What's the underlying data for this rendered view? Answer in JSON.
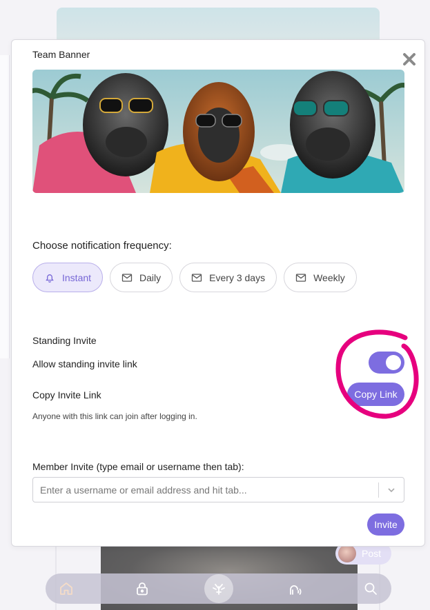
{
  "modal": {
    "banner_label": "Team Banner",
    "frequency_label": "Choose notification frequency:",
    "frequency_options": [
      {
        "label": "Instant",
        "icon": "bell-icon",
        "selected": true
      },
      {
        "label": "Daily",
        "icon": "mail-icon",
        "selected": false
      },
      {
        "label": "Every 3 days",
        "icon": "mail-icon",
        "selected": false
      },
      {
        "label": "Weekly",
        "icon": "mail-icon",
        "selected": false
      }
    ],
    "standing_invite_title": "Standing Invite",
    "allow_standing_label": "Allow standing invite link",
    "allow_standing_enabled": true,
    "copy_invite_label": "Copy Invite Link",
    "copy_button": "Copy Link",
    "helper_text": "Anyone with this link can join after logging in.",
    "member_invite_label": "Member Invite (type email or username then tab):",
    "member_invite_placeholder": "Enter a username or email address and hit tab...",
    "invite_button": "Invite"
  },
  "background": {
    "post_button": "Post"
  },
  "bottom_nav": [
    {
      "icon": "home-icon"
    },
    {
      "icon": "lock-icon"
    },
    {
      "icon": "community-logo-icon"
    },
    {
      "icon": "broadcast-icon"
    },
    {
      "icon": "search-icon"
    }
  ],
  "colors": {
    "accent": "#7d6de0",
    "annotation": "#e6007e",
    "chip_active_bg": "#ece9fb"
  }
}
